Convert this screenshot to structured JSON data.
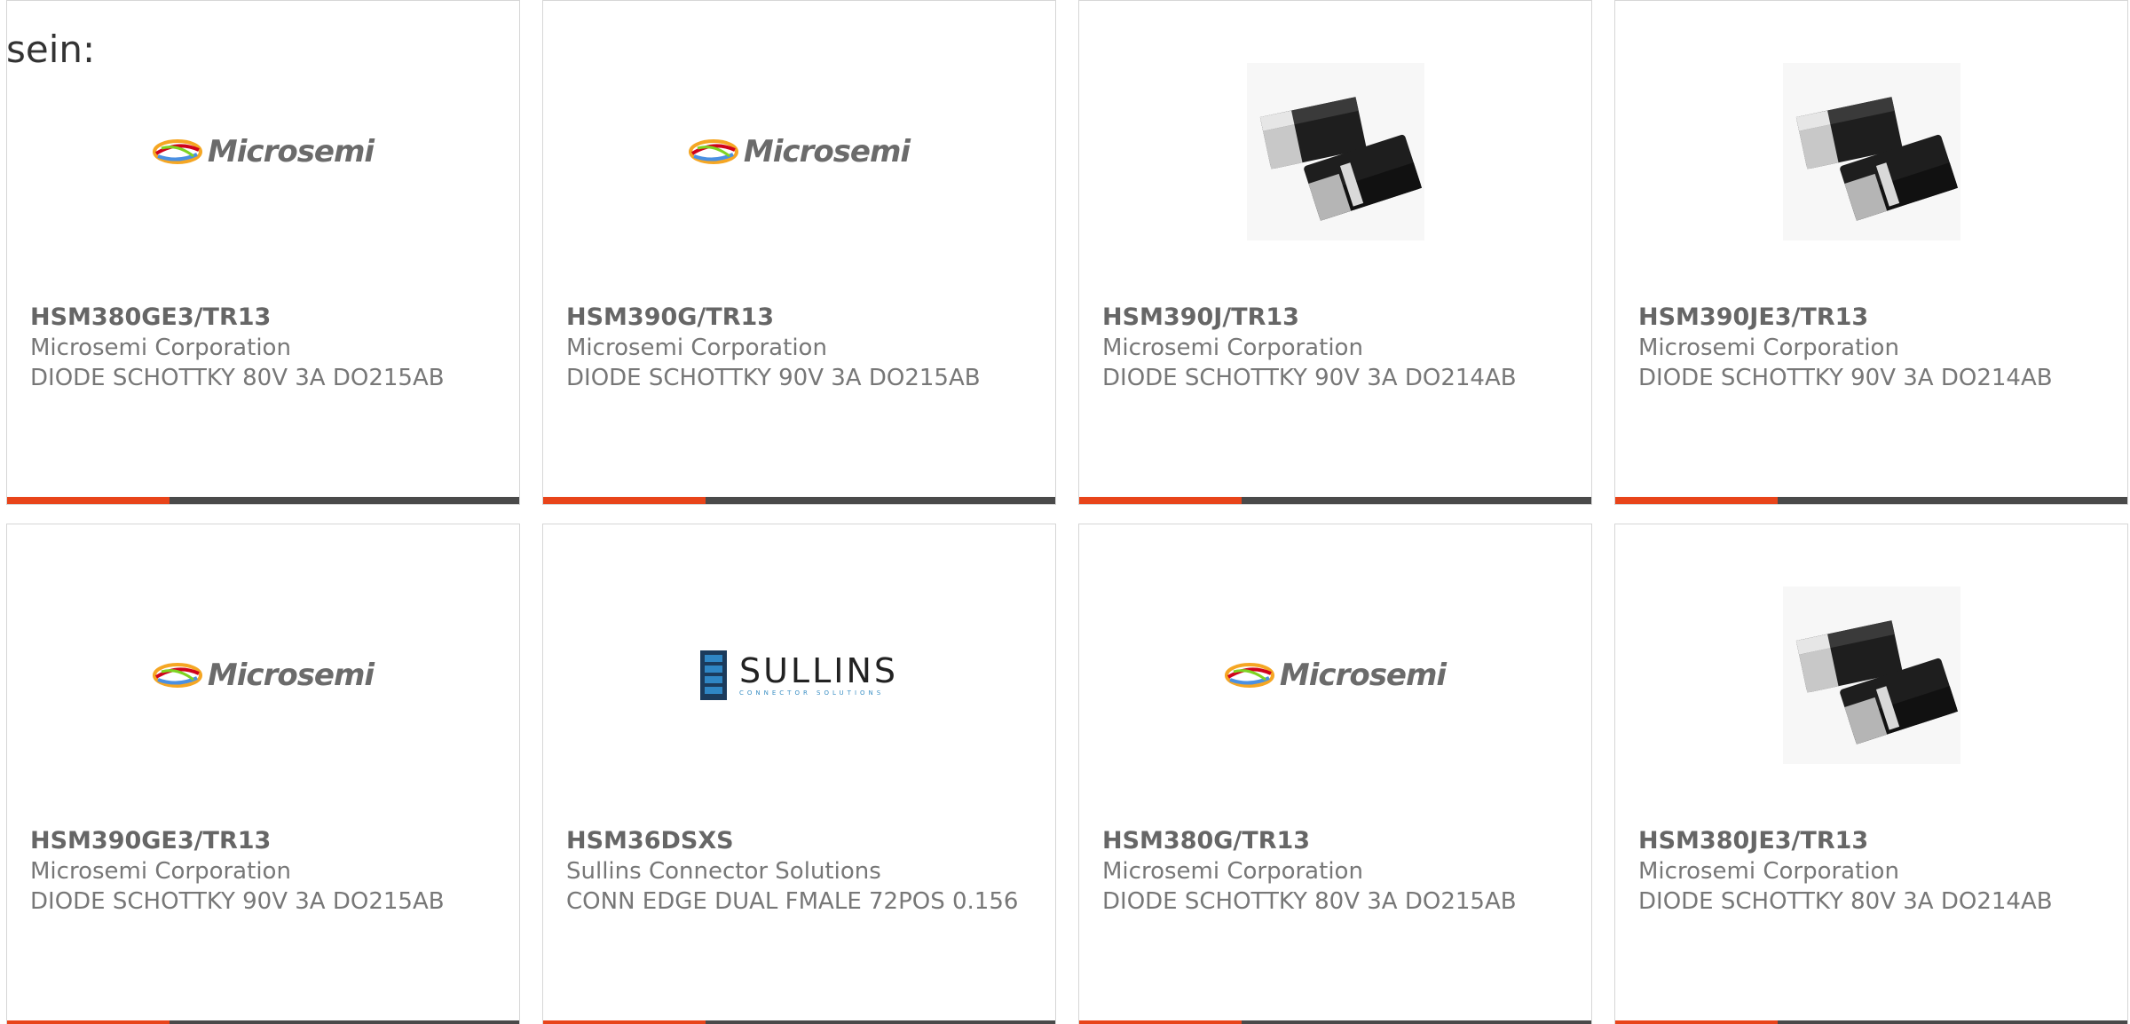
{
  "intro_text": "sein:",
  "colors": {
    "accent": "#e8441a",
    "bar": "#4a4a4a",
    "border": "#d6d6d6"
  },
  "logos": {
    "microsemi": "Microsemi",
    "sullins": "SULLINS",
    "sullins_sub": "CONNECTOR SOLUTIONS"
  },
  "products": [
    {
      "part": "HSM380GE3/TR13",
      "mfr": "Microsemi Corporation",
      "desc": "DIODE SCHOTTKY 80V 3A DO215AB",
      "image": "microsemi-logo"
    },
    {
      "part": "HSM390G/TR13",
      "mfr": "Microsemi Corporation",
      "desc": "DIODE SCHOTTKY 90V 3A DO215AB",
      "image": "microsemi-logo"
    },
    {
      "part": "HSM390J/TR13",
      "mfr": "Microsemi Corporation",
      "desc": "DIODE SCHOTTKY 90V 3A DO214AB",
      "image": "smd-diode-photo"
    },
    {
      "part": "HSM390JE3/TR13",
      "mfr": "Microsemi Corporation",
      "desc": "DIODE SCHOTTKY 90V 3A DO214AB",
      "image": "smd-diode-photo"
    },
    {
      "part": "HSM390GE3/TR13",
      "mfr": "Microsemi Corporation",
      "desc": "DIODE SCHOTTKY 90V 3A DO215AB",
      "image": "microsemi-logo"
    },
    {
      "part": "HSM36DSXS",
      "mfr": "Sullins Connector Solutions",
      "desc": "CONN EDGE DUAL FMALE 72POS 0.156",
      "image": "sullins-logo"
    },
    {
      "part": "HSM380G/TR13",
      "mfr": "Microsemi Corporation",
      "desc": "DIODE SCHOTTKY 80V 3A DO215AB",
      "image": "microsemi-logo"
    },
    {
      "part": "HSM380JE3/TR13",
      "mfr": "Microsemi Corporation",
      "desc": "DIODE SCHOTTKY 80V 3A DO214AB",
      "image": "smd-diode-photo"
    }
  ]
}
